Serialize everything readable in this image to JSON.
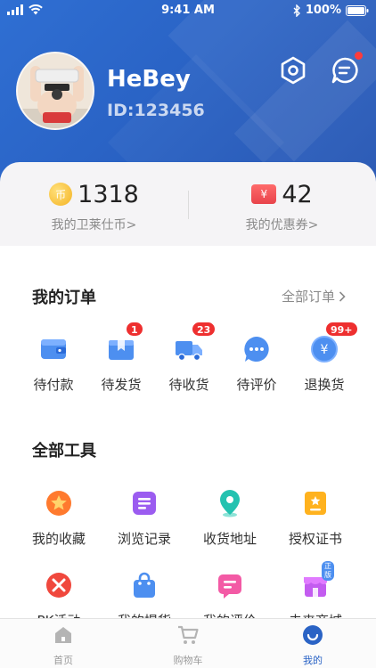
{
  "status_bar": {
    "time": "9:41 AM",
    "battery": "100%"
  },
  "profile": {
    "name": "HeBey",
    "id": "ID:123456"
  },
  "header_icons": {
    "settings": "settings-icon",
    "message": "message-icon"
  },
  "stats": {
    "coins": {
      "value": "1318",
      "label": "我的卫莱仕币>",
      "icon_text": "币"
    },
    "coupons": {
      "value": "42",
      "label": "我的优惠券>",
      "icon_text": "¥"
    }
  },
  "orders": {
    "title": "我的订单",
    "see_all": "全部订单",
    "items": [
      {
        "label": "待付款",
        "icon": "wallet-icon",
        "badge": ""
      },
      {
        "label": "待发货",
        "icon": "package-icon",
        "badge": "1"
      },
      {
        "label": "待收货",
        "icon": "truck-icon",
        "badge": "23"
      },
      {
        "label": "待评价",
        "icon": "chat-icon",
        "badge": ""
      },
      {
        "label": "退换货",
        "icon": "refund-icon",
        "badge": "99+"
      }
    ]
  },
  "tools": {
    "title": "全部工具",
    "items": [
      {
        "label": "我的收藏",
        "icon": "star-icon"
      },
      {
        "label": "浏览记录",
        "icon": "history-icon"
      },
      {
        "label": "收货地址",
        "icon": "location-icon"
      },
      {
        "label": "授权证书",
        "icon": "certificate-icon"
      },
      {
        "label": "PK活动",
        "icon": "pk-icon"
      },
      {
        "label": "我的提货",
        "icon": "bag-icon"
      },
      {
        "label": "我的评价",
        "icon": "review-icon"
      },
      {
        "label": "未来商城",
        "icon": "store-icon",
        "tag": "正版"
      }
    ]
  },
  "tabbar": {
    "items": [
      {
        "label": "首页",
        "icon": "home-icon"
      },
      {
        "label": "购物车",
        "icon": "cart-icon"
      },
      {
        "label": "我的",
        "icon": "profile-icon"
      }
    ],
    "active": "我的"
  },
  "colors": {
    "primary": "#2f6fd3",
    "accent_red": "#ee2f2f",
    "active_tab": "#2a63c5"
  }
}
